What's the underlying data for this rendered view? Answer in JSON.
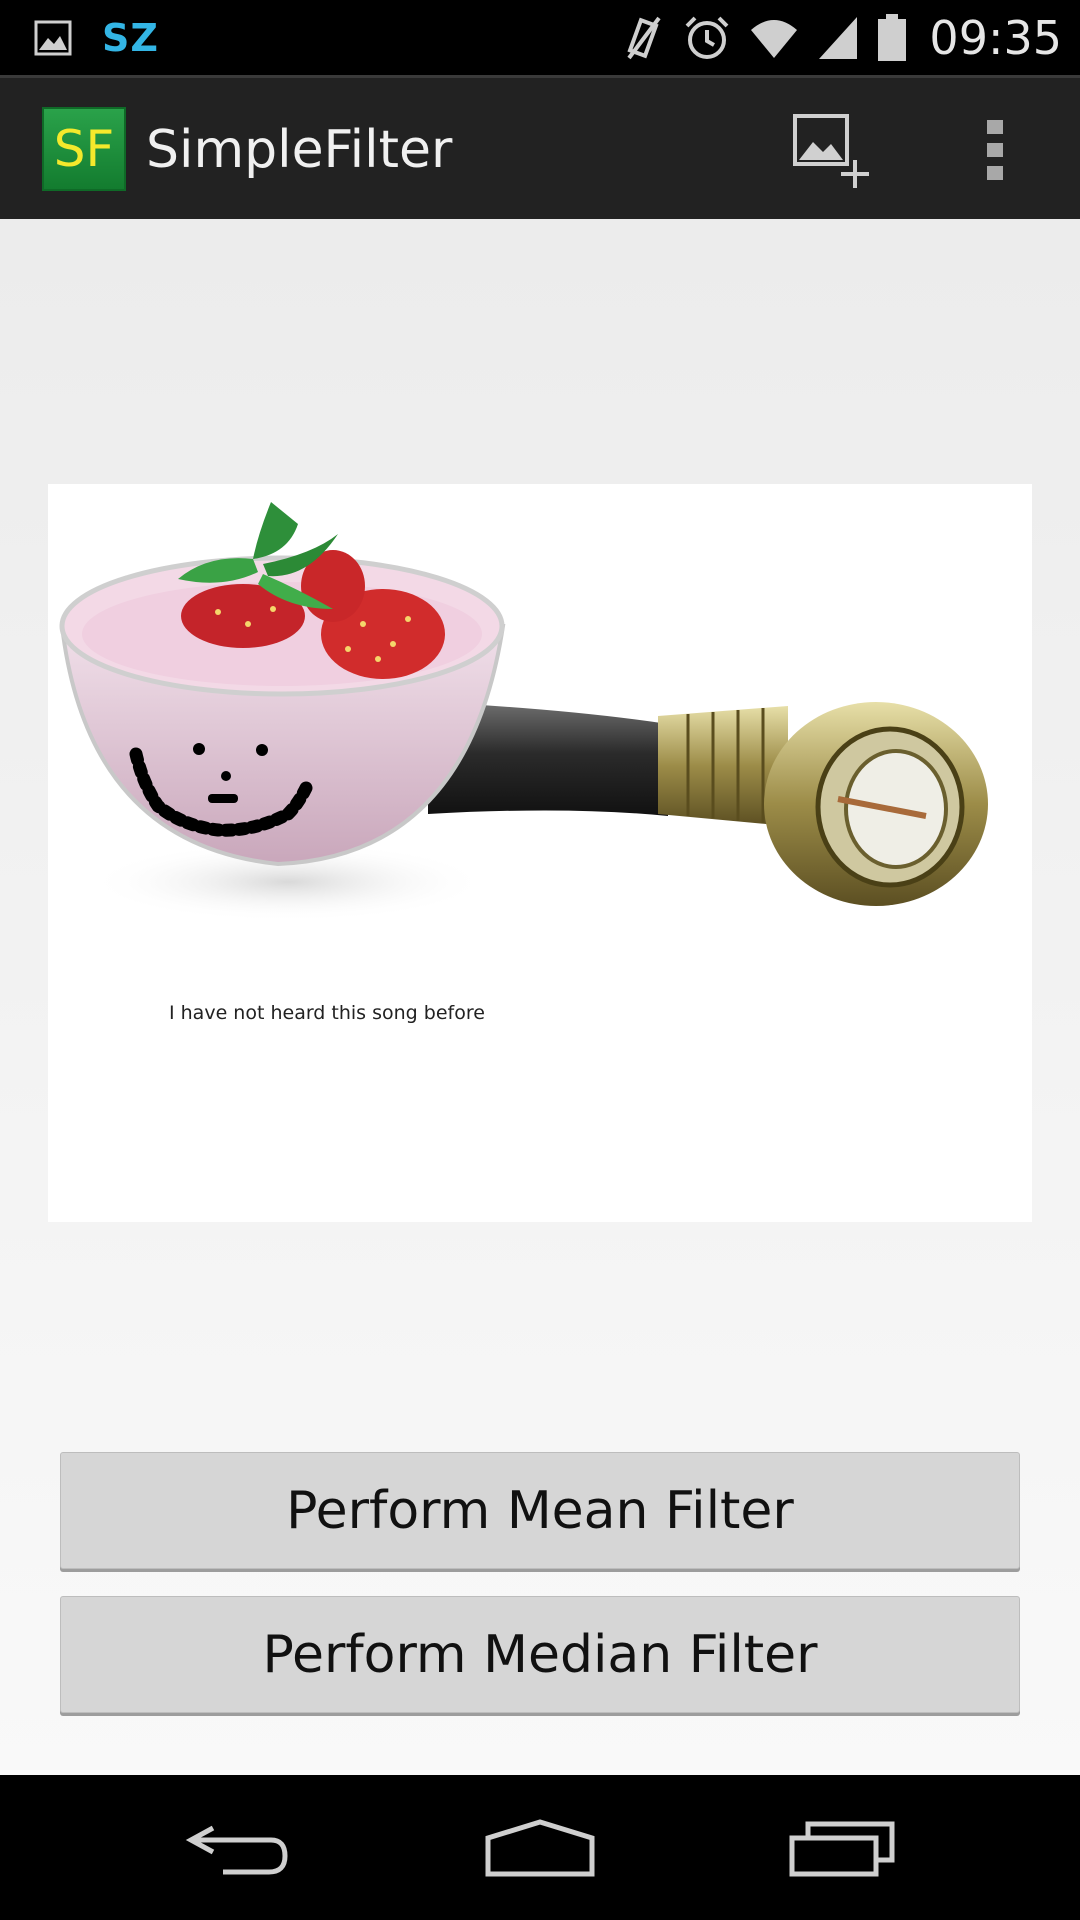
{
  "status_bar": {
    "notification_label": "SZ",
    "time": "09:35",
    "icons": [
      "image-notification-icon",
      "vibrate-mute-icon",
      "alarm-icon",
      "wifi-icon",
      "signal-icon",
      "battery-icon"
    ]
  },
  "action_bar": {
    "app_logo_text": "SF",
    "title": "SimpleFilter",
    "actions": [
      "add-image-icon",
      "overflow-menu-icon"
    ]
  },
  "image_view": {
    "caption": "I have not heard this song before"
  },
  "buttons": {
    "mean_filter": "Perform Mean Filter",
    "median_filter": "Perform Median Filter"
  },
  "nav_bar": {
    "buttons": [
      "back-icon",
      "home-icon",
      "recents-icon"
    ]
  },
  "colors": {
    "accent": "#33b5e5",
    "action_bar": "#222222",
    "button": "#d6d6d6",
    "logo_bg": "#1f8f3c",
    "logo_text": "#f4e92c"
  }
}
